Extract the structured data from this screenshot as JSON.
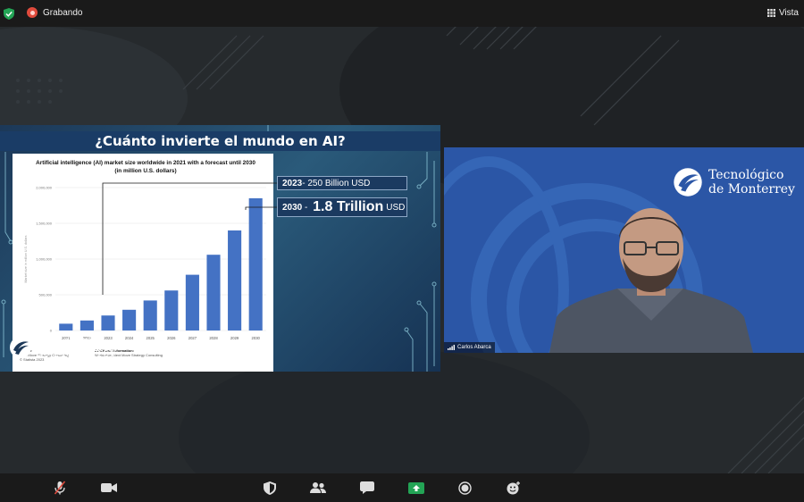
{
  "top_bar": {
    "recording_label": "Grabando",
    "view_label": "Vista",
    "icons": [
      "shield-check-icon",
      "record-icon",
      "grid-view-icon"
    ]
  },
  "slide": {
    "title": "¿Cuánto invierte el mundo en AI?",
    "chart_card": {
      "title": "Artificial intelligence (AI) market size worldwide in 2021 with a forecast until 2030 (in million U.S. dollars)",
      "source_heading": "Source",
      "source_lines": [
        "Next Move Strategy Consulting",
        "© Statista 2023"
      ],
      "additional_heading": "Additional Information:",
      "additional_lines": [
        "Worldwide; Next Move Strategy Consulting"
      ],
      "y_axis_label": "Market size in million U.S. dollars"
    },
    "callout_2023": {
      "year": "2023",
      "text": " - 250 Billion USD"
    },
    "callout_2030": {
      "year": "2030",
      "dash": " - ",
      "amount": "1.8 Trillion",
      "unit": "USD"
    },
    "logo_line1": "Tecnológico",
    "logo_line2": "de Monterrey"
  },
  "chart_data": {
    "type": "bar",
    "title": "Artificial intelligence (AI) market size worldwide in 2021 with a forecast until 2030 (in million U.S. dollars)",
    "categories": [
      "2021",
      "2022",
      "2023",
      "2024",
      "2025",
      "2026",
      "2027",
      "2028",
      "2029",
      "2030"
    ],
    "values": [
      95000,
      140000,
      210000,
      290000,
      420000,
      560000,
      780000,
      1060000,
      1400000,
      1850000
    ],
    "ylim": [
      0,
      2000000
    ],
    "yticks": [
      "0",
      "500,000",
      "1,000,000",
      "1,500,000",
      "2,000,000"
    ],
    "ylabel": "Market size in million U.S. dollars",
    "bar_color": "#4472c4",
    "grid": true
  },
  "video": {
    "participant_name": "Carlos Abarca",
    "logo_line1": "Tecnológico",
    "logo_line2": "de Monterrey",
    "background_color": "#2b56a6"
  },
  "toolbar": {
    "buttons": [
      {
        "name": "mute-button",
        "icon": "microphone-muted-icon"
      },
      {
        "name": "video-button",
        "icon": "video-camera-icon"
      },
      {
        "name": "security-button",
        "icon": "shield-icon"
      },
      {
        "name": "participants-button",
        "icon": "participants-icon"
      },
      {
        "name": "chat-button",
        "icon": "chat-icon"
      },
      {
        "name": "share-screen-button",
        "icon": "share-screen-icon"
      },
      {
        "name": "record-button",
        "icon": "record-icon"
      },
      {
        "name": "reactions-button",
        "icon": "emoji-icon"
      }
    ],
    "share_color": "#23a455"
  }
}
